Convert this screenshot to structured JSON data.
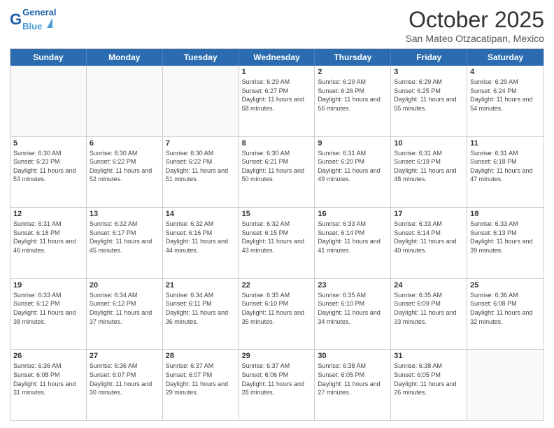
{
  "header": {
    "logo_general": "General",
    "logo_blue": "Blue",
    "month_title": "October 2025",
    "location": "San Mateo Otzacatipan, Mexico"
  },
  "weekdays": [
    "Sunday",
    "Monday",
    "Tuesday",
    "Wednesday",
    "Thursday",
    "Friday",
    "Saturday"
  ],
  "rows": [
    [
      {
        "day": "",
        "info": ""
      },
      {
        "day": "",
        "info": ""
      },
      {
        "day": "",
        "info": ""
      },
      {
        "day": "1",
        "info": "Sunrise: 6:29 AM\nSunset: 6:27 PM\nDaylight: 11 hours\nand 58 minutes."
      },
      {
        "day": "2",
        "info": "Sunrise: 6:29 AM\nSunset: 6:26 PM\nDaylight: 11 hours\nand 56 minutes."
      },
      {
        "day": "3",
        "info": "Sunrise: 6:29 AM\nSunset: 6:25 PM\nDaylight: 11 hours\nand 55 minutes."
      },
      {
        "day": "4",
        "info": "Sunrise: 6:29 AM\nSunset: 6:24 PM\nDaylight: 11 hours\nand 54 minutes."
      }
    ],
    [
      {
        "day": "5",
        "info": "Sunrise: 6:30 AM\nSunset: 6:23 PM\nDaylight: 11 hours\nand 53 minutes."
      },
      {
        "day": "6",
        "info": "Sunrise: 6:30 AM\nSunset: 6:22 PM\nDaylight: 11 hours\nand 52 minutes."
      },
      {
        "day": "7",
        "info": "Sunrise: 6:30 AM\nSunset: 6:22 PM\nDaylight: 11 hours\nand 51 minutes."
      },
      {
        "day": "8",
        "info": "Sunrise: 6:30 AM\nSunset: 6:21 PM\nDaylight: 11 hours\nand 50 minutes."
      },
      {
        "day": "9",
        "info": "Sunrise: 6:31 AM\nSunset: 6:20 PM\nDaylight: 11 hours\nand 49 minutes."
      },
      {
        "day": "10",
        "info": "Sunrise: 6:31 AM\nSunset: 6:19 PM\nDaylight: 11 hours\nand 48 minutes."
      },
      {
        "day": "11",
        "info": "Sunrise: 6:31 AM\nSunset: 6:18 PM\nDaylight: 11 hours\nand 47 minutes."
      }
    ],
    [
      {
        "day": "12",
        "info": "Sunrise: 6:31 AM\nSunset: 6:18 PM\nDaylight: 11 hours\nand 46 minutes."
      },
      {
        "day": "13",
        "info": "Sunrise: 6:32 AM\nSunset: 6:17 PM\nDaylight: 11 hours\nand 45 minutes."
      },
      {
        "day": "14",
        "info": "Sunrise: 6:32 AM\nSunset: 6:16 PM\nDaylight: 11 hours\nand 44 minutes."
      },
      {
        "day": "15",
        "info": "Sunrise: 6:32 AM\nSunset: 6:15 PM\nDaylight: 11 hours\nand 43 minutes."
      },
      {
        "day": "16",
        "info": "Sunrise: 6:33 AM\nSunset: 6:14 PM\nDaylight: 11 hours\nand 41 minutes."
      },
      {
        "day": "17",
        "info": "Sunrise: 6:33 AM\nSunset: 6:14 PM\nDaylight: 11 hours\nand 40 minutes."
      },
      {
        "day": "18",
        "info": "Sunrise: 6:33 AM\nSunset: 6:13 PM\nDaylight: 11 hours\nand 39 minutes."
      }
    ],
    [
      {
        "day": "19",
        "info": "Sunrise: 6:33 AM\nSunset: 6:12 PM\nDaylight: 11 hours\nand 38 minutes."
      },
      {
        "day": "20",
        "info": "Sunrise: 6:34 AM\nSunset: 6:12 PM\nDaylight: 11 hours\nand 37 minutes."
      },
      {
        "day": "21",
        "info": "Sunrise: 6:34 AM\nSunset: 6:11 PM\nDaylight: 11 hours\nand 36 minutes."
      },
      {
        "day": "22",
        "info": "Sunrise: 6:35 AM\nSunset: 6:10 PM\nDaylight: 11 hours\nand 35 minutes."
      },
      {
        "day": "23",
        "info": "Sunrise: 6:35 AM\nSunset: 6:10 PM\nDaylight: 11 hours\nand 34 minutes."
      },
      {
        "day": "24",
        "info": "Sunrise: 6:35 AM\nSunset: 6:09 PM\nDaylight: 11 hours\nand 33 minutes."
      },
      {
        "day": "25",
        "info": "Sunrise: 6:36 AM\nSunset: 6:08 PM\nDaylight: 11 hours\nand 32 minutes."
      }
    ],
    [
      {
        "day": "26",
        "info": "Sunrise: 6:36 AM\nSunset: 6:08 PM\nDaylight: 11 hours\nand 31 minutes."
      },
      {
        "day": "27",
        "info": "Sunrise: 6:36 AM\nSunset: 6:07 PM\nDaylight: 11 hours\nand 30 minutes."
      },
      {
        "day": "28",
        "info": "Sunrise: 6:37 AM\nSunset: 6:07 PM\nDaylight: 11 hours\nand 29 minutes."
      },
      {
        "day": "29",
        "info": "Sunrise: 6:37 AM\nSunset: 6:06 PM\nDaylight: 11 hours\nand 28 minutes."
      },
      {
        "day": "30",
        "info": "Sunrise: 6:38 AM\nSunset: 6:05 PM\nDaylight: 11 hours\nand 27 minutes."
      },
      {
        "day": "31",
        "info": "Sunrise: 6:38 AM\nSunset: 6:05 PM\nDaylight: 11 hours\nand 26 minutes."
      },
      {
        "day": "",
        "info": ""
      }
    ]
  ]
}
